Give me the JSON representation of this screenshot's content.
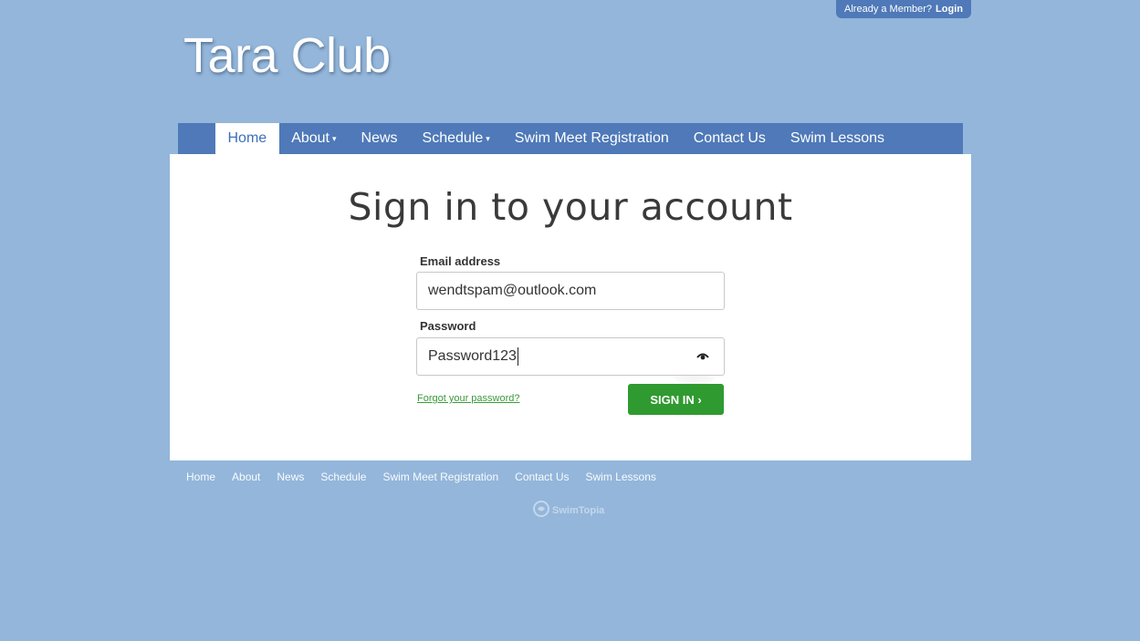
{
  "header": {
    "member_prefix": "Already a Member?",
    "login_label": "Login",
    "site_title": "Tara Club"
  },
  "nav": {
    "items": [
      {
        "label": "Home",
        "active": true,
        "has_caret": false
      },
      {
        "label": "About",
        "active": false,
        "has_caret": true
      },
      {
        "label": "News",
        "active": false,
        "has_caret": false
      },
      {
        "label": "Schedule",
        "active": false,
        "has_caret": true
      },
      {
        "label": "Swim Meet Registration",
        "active": false,
        "has_caret": false
      },
      {
        "label": "Contact Us",
        "active": false,
        "has_caret": false
      },
      {
        "label": "Swim Lessons",
        "active": false,
        "has_caret": false
      }
    ]
  },
  "signin": {
    "heading": "Sign in to your account",
    "email_label": "Email address",
    "email_value": "wendtspam@outlook.com",
    "password_label": "Password",
    "password_value": "Password123",
    "forgot_label": "Forgot your password?",
    "submit_label": "SIGN IN ›"
  },
  "footer": {
    "links": [
      "Home",
      "About",
      "News",
      "Schedule",
      "Swim Meet Registration",
      "Contact Us",
      "Swim Lessons"
    ],
    "brand": "SwimTopia"
  },
  "colors": {
    "page_background": "#93b6da",
    "nav_background": "#4f79b8",
    "active_tab_text": "#3f6fb8",
    "primary_button": "#2f9a2f",
    "link_green": "#3a9a3a"
  },
  "icons": {
    "password_toggle": "eye-icon",
    "brand_logo": "swimtopia-logo-icon"
  }
}
